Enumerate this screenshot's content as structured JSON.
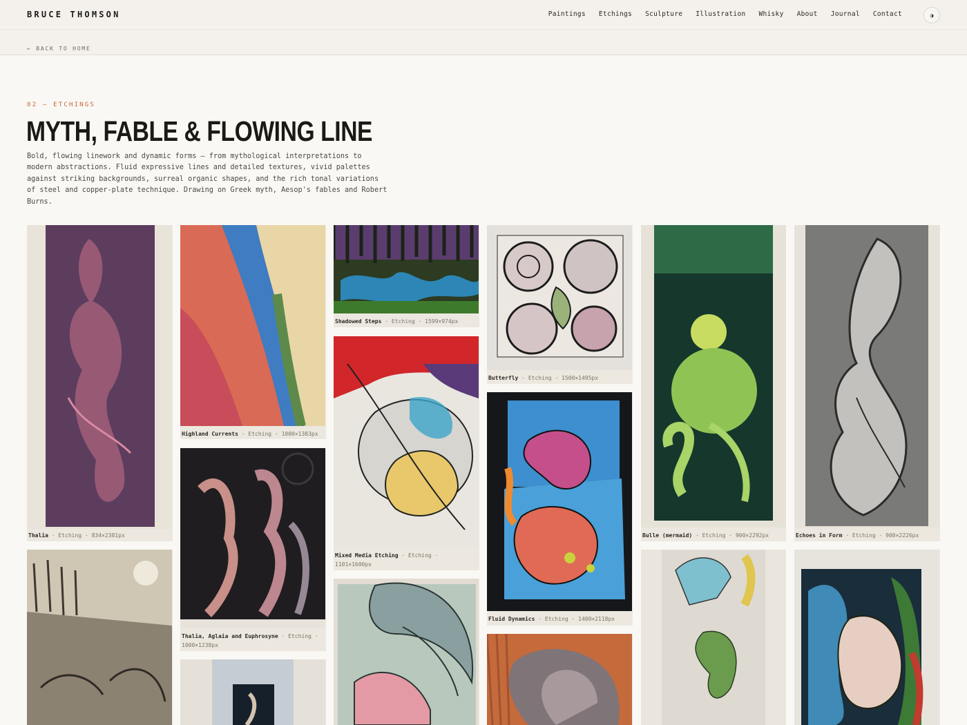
{
  "header": {
    "brand": "BRUCE THOMSON",
    "nav": [
      "Paintings",
      "Etchings",
      "Sculpture",
      "Illustration",
      "Whisky",
      "About",
      "Journal",
      "Contact"
    ],
    "theme_toggle": "◑"
  },
  "back_link": "← BACK TO HOME",
  "section": {
    "eyebrow": "02 — ETCHINGS",
    "title": "MYTH, FABLE & FLOWING LINE",
    "description": "Bold, flowing linework and dynamic forms — from mythological interpretations to modern abstractions. Fluid expressive lines and detailed textures, vivid palettes against striking backgrounds, surreal organic shapes, and the rich tonal variations of steel and copper-plate technique. Drawing on Greek myth, Aesop's fables and Robert Burns."
  },
  "gallery": [
    {
      "title": "Thalia",
      "medium": "Etching",
      "size": "834×2381px"
    },
    {
      "title": "Highland Currents",
      "medium": "Etching",
      "size": "1000×1383px"
    },
    {
      "title": "Shadowed Steps",
      "medium": "Etching",
      "size": "1599×974px"
    },
    {
      "title": "Butterfly",
      "medium": "Etching",
      "size": "1500×1495px"
    },
    {
      "title": "Bulle (mermaid)",
      "medium": "Etching",
      "size": "900×2292px"
    },
    {
      "title": "Echoes in Form",
      "medium": "Etching",
      "size": "900×2226px"
    },
    {
      "title": "Thalia, Aglaia and Euphrosyne",
      "medium": "Etching",
      "size": "1000×1238px"
    },
    {
      "title": "Mixed Media Etching",
      "medium": "Etching",
      "size": "1101×1600px"
    },
    {
      "title": "Fluid Dynamics",
      "medium": "Etching",
      "size": "1400×2118px"
    }
  ],
  "caption_separator": "·"
}
